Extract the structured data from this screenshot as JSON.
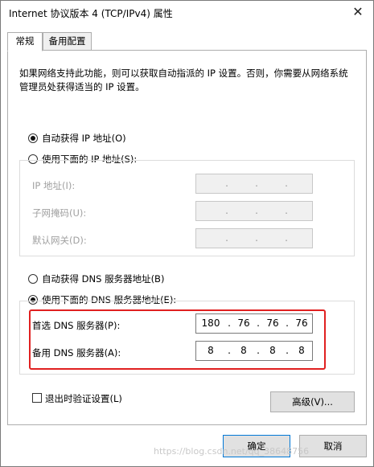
{
  "window": {
    "title": "Internet 协议版本 4 (TCP/IPv4) 属性"
  },
  "tabs": [
    {
      "label": "常规",
      "active": true
    },
    {
      "label": "备用配置",
      "active": false
    }
  ],
  "description": "如果网络支持此功能，则可以获取自动指派的 IP 设置。否则，你需要从网络系统管理员处获得适当的 IP 设置。",
  "ip_section": {
    "auto_option": "自动获得 IP 地址(O)",
    "manual_option": "使用下面的 IP 地址(S):",
    "selected": "auto",
    "fields": [
      {
        "label": "IP 地址(I):",
        "value": [
          "",
          "",
          "",
          ""
        ]
      },
      {
        "label": "子网掩码(U):",
        "value": [
          "",
          "",
          "",
          ""
        ]
      },
      {
        "label": "默认网关(D):",
        "value": [
          "",
          "",
          "",
          ""
        ]
      }
    ]
  },
  "dns_section": {
    "auto_option": "自动获得 DNS 服务器地址(B)",
    "manual_option": "使用下面的 DNS 服务器地址(E):",
    "selected": "manual",
    "preferred": {
      "label": "首选 DNS 服务器(P):",
      "value": [
        "180",
        "76",
        "76",
        "76"
      ]
    },
    "alternate": {
      "label": "备用 DNS 服务器(A):",
      "value": [
        "8",
        "8",
        "8",
        "8"
      ]
    }
  },
  "validate_on_exit": {
    "label": "退出时验证设置(L)",
    "checked": false
  },
  "buttons": {
    "advanced": "高级(V)...",
    "ok": "确定",
    "cancel": "取消"
  },
  "watermark": "https://blog.csdn.net/qq_38648756",
  "colors": {
    "highlight": "#e02020",
    "default_button_border": "#0078d7"
  }
}
